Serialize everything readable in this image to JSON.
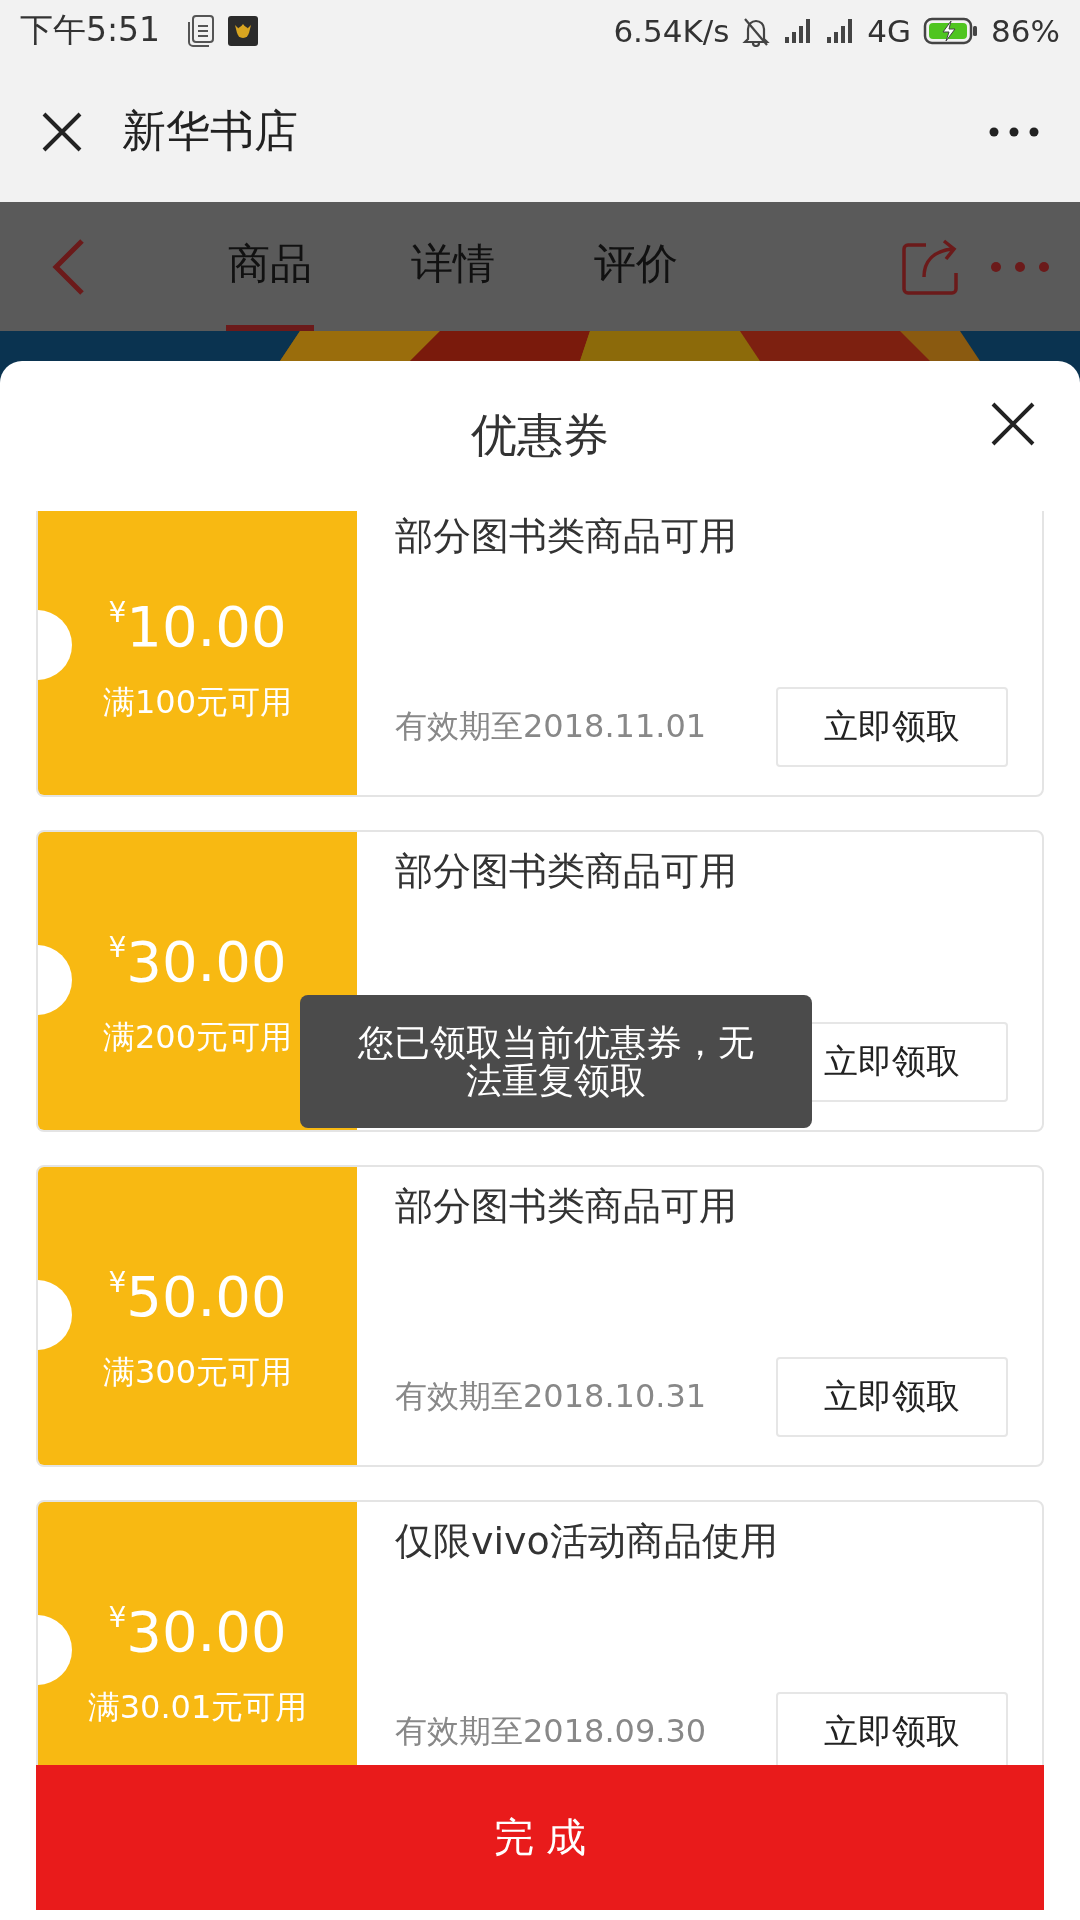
{
  "status_bar": {
    "time": "下午5:51",
    "speed": "6.54K/s",
    "network": "4G",
    "battery": "86%"
  },
  "title_bar": {
    "title": "新华书店"
  },
  "nav": {
    "tabs": [
      {
        "label": "商品",
        "selected": true
      },
      {
        "label": "详情",
        "selected": false
      },
      {
        "label": "评价",
        "selected": false
      }
    ]
  },
  "sheet": {
    "title": "优惠券",
    "coupons": [
      {
        "amount": "$^{¥}$10.00",
        "condition": "满100元可用",
        "scope": "部分图书类商品可用",
        "expiry": "有效期至2018.11.01",
        "button": "立即领取"
      },
      {
        "amount": "$^{¥}$30.00",
        "condition": "满200元可用",
        "scope": "部分图书类商品可用",
        "button": "立即领取"
      },
      {
        "amount": "$^{¥}$50.00",
        "condition": "满300元可用",
        "scope": "部分图书类商品可用",
        "expiry": "有效期至2018.10.31",
        "button": "立即领取"
      },
      {
        "amount": "$^{¥}$30.00",
        "condition": "满30.01元可用",
        "scope": "仅限vivo活动商品使用",
        "expiry": "有效期至2018.09.30",
        "button": "立即领取"
      }
    ],
    "done_button": "完 成"
  },
  "toast": {
    "text": "您已领取当前优惠券，无法重复领取"
  }
}
